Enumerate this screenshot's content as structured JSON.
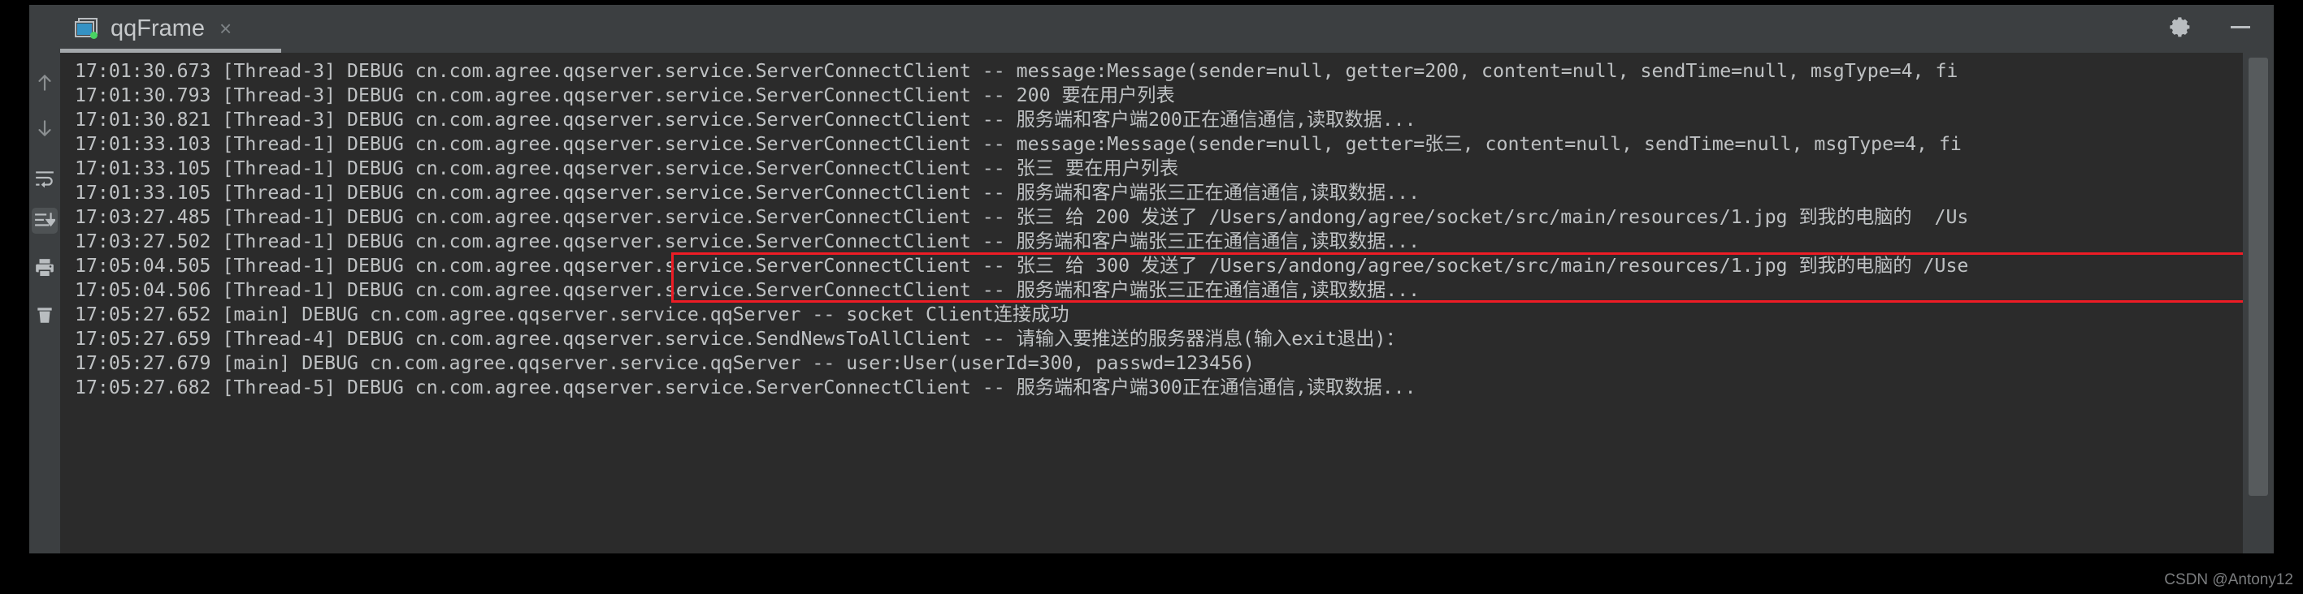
{
  "window": {
    "tab_label": "qqFrame",
    "tab_close_label": "×",
    "icons": {
      "frame": "frame-icon",
      "settings": "gear-icon",
      "minimize": "minimize-icon"
    }
  },
  "toolbar": {
    "items": [
      {
        "name": "up-arrow-icon",
        "tooltip": "Up the Stack Trace",
        "active": false
      },
      {
        "name": "down-arrow-icon",
        "tooltip": "Down the Stack Trace",
        "active": false
      },
      {
        "name": "soft-wrap-icon",
        "tooltip": "Soft-Wrap",
        "active": false
      },
      {
        "name": "scroll-to-end-icon",
        "tooltip": "Scroll to the end",
        "active": true
      },
      {
        "name": "print-icon",
        "tooltip": "Print",
        "active": false
      },
      {
        "name": "trash-icon",
        "tooltip": "Clear All",
        "active": false
      }
    ]
  },
  "console": {
    "lines": [
      "17:01:30.673 [Thread-3] DEBUG cn.com.agree.qqserver.service.ServerConnectClient -- message:Message(sender=null, getter=200, content=null, sendTime=null, msgType=4, fi",
      "17:01:30.793 [Thread-3] DEBUG cn.com.agree.qqserver.service.ServerConnectClient -- 200 要在用户列表",
      "17:01:30.821 [Thread-3] DEBUG cn.com.agree.qqserver.service.ServerConnectClient -- 服务端和客户端200正在通信通信,读取数据...",
      "17:01:33.103 [Thread-1] DEBUG cn.com.agree.qqserver.service.ServerConnectClient -- message:Message(sender=null, getter=张三, content=null, sendTime=null, msgType=4, fi",
      "17:01:33.105 [Thread-1] DEBUG cn.com.agree.qqserver.service.ServerConnectClient -- 张三 要在用户列表",
      "17:01:33.105 [Thread-1] DEBUG cn.com.agree.qqserver.service.ServerConnectClient -- 服务端和客户端张三正在通信通信,读取数据...",
      "17:03:27.485 [Thread-1] DEBUG cn.com.agree.qqserver.service.ServerConnectClient -- 张三 给 200 发送了 /Users/andong/agree/socket/src/main/resources/1.jpg 到我的电脑的  /Us",
      "17:03:27.502 [Thread-1] DEBUG cn.com.agree.qqserver.service.ServerConnectClient -- 服务端和客户端张三正在通信通信,读取数据...",
      "17:05:04.505 [Thread-1] DEBUG cn.com.agree.qqserver.service.ServerConnectClient -- 张三 给 300 发送了 /Users/andong/agree/socket/src/main/resources/1.jpg 到我的电脑的 /Use",
      "17:05:04.506 [Thread-1] DEBUG cn.com.agree.qqserver.service.ServerConnectClient -- 服务端和客户端张三正在通信通信,读取数据...",
      "17:05:27.652 [main] DEBUG cn.com.agree.qqserver.service.qqServer -- socket Client连接成功",
      "17:05:27.659 [Thread-4] DEBUG cn.com.agree.qqserver.service.SendNewsToAllClient -- 请输入要推送的服务器消息(输入exit退出)：",
      "17:05:27.679 [main] DEBUG cn.com.agree.qqserver.service.qqServer -- user:User(userId=300, passwd=123456)",
      "17:05:27.682 [Thread-5] DEBUG cn.com.agree.qqserver.service.ServerConnectClient -- 服务端和客户端300正在通信通信,读取数据..."
    ],
    "highlight": {
      "color": "#ee1c25",
      "from_line_index": 8,
      "to_line_index": 9
    }
  },
  "watermark": {
    "text": "CSDN @Antony12"
  },
  "colors": {
    "console_bg": "#2b2b2b",
    "chrome_bg": "#3c3f41",
    "text": "#bfc2c4",
    "accent_blue": "#3592c4",
    "status_green": "#49d463",
    "highlight_red": "#ee1c25"
  }
}
